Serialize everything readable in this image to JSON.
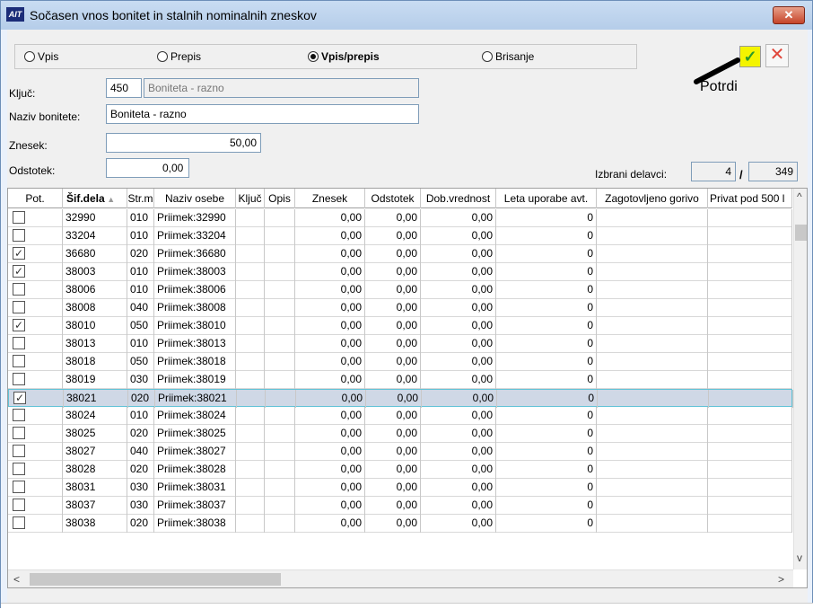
{
  "window": {
    "title": "Sočasen vnos bonitet in stalnih nominalnih zneskov",
    "icon_text": "AIT",
    "close_symbol": "✕"
  },
  "modes": [
    {
      "label": "Vpis",
      "selected": false
    },
    {
      "label": "Prepis",
      "selected": false
    },
    {
      "label": "Vpis/prepis",
      "selected": true
    },
    {
      "label": "Brisanje",
      "selected": false
    }
  ],
  "actions": {
    "confirm_symbol": "✓",
    "cancel_symbol": "✕",
    "annotation": "Potrdi"
  },
  "form": {
    "kljuc_label": "Ključ:",
    "kljuc_value": "450",
    "kljuc_desc": "Boniteta - razno",
    "naziv_label": "Naziv bonitete:",
    "naziv_value": "Boniteta - razno",
    "znesek_label": "Znesek:",
    "znesek_value": "50,00",
    "odstotek_label": "Odstotek:",
    "odstotek_value": "0,00",
    "izbrani_label": "Izbrani delavci:",
    "izbrani_count": "4",
    "izbrani_sep": "/",
    "izbrani_total": "349"
  },
  "grid": {
    "columns": [
      "Pot.",
      "Šif.dela",
      "Str.m",
      "Naziv osebe",
      "Ključ",
      "Opis",
      "Znesek",
      "Odstotek",
      "Dob.vrednost",
      "Leta uporabe avt.",
      "Zagotovljeno gorivo",
      "Privat pod 500 l"
    ],
    "rows": [
      {
        "pot": false,
        "sif": "32990",
        "str": "010",
        "naziv": "Priimek:32990",
        "znesek": "0,00",
        "odstotek": "0,00",
        "dob": "0,00",
        "leta": "0"
      },
      {
        "pot": false,
        "sif": "33204",
        "str": "010",
        "naziv": "Priimek:33204",
        "znesek": "0,00",
        "odstotek": "0,00",
        "dob": "0,00",
        "leta": "0"
      },
      {
        "pot": true,
        "sif": "36680",
        "str": "020",
        "naziv": "Priimek:36680",
        "znesek": "0,00",
        "odstotek": "0,00",
        "dob": "0,00",
        "leta": "0"
      },
      {
        "pot": true,
        "sif": "38003",
        "str": "010",
        "naziv": "Priimek:38003",
        "znesek": "0,00",
        "odstotek": "0,00",
        "dob": "0,00",
        "leta": "0"
      },
      {
        "pot": false,
        "sif": "38006",
        "str": "010",
        "naziv": "Priimek:38006",
        "znesek": "0,00",
        "odstotek": "0,00",
        "dob": "0,00",
        "leta": "0"
      },
      {
        "pot": false,
        "sif": "38008",
        "str": "040",
        "naziv": "Priimek:38008",
        "znesek": "0,00",
        "odstotek": "0,00",
        "dob": "0,00",
        "leta": "0"
      },
      {
        "pot": true,
        "sif": "38010",
        "str": "050",
        "naziv": "Priimek:38010",
        "znesek": "0,00",
        "odstotek": "0,00",
        "dob": "0,00",
        "leta": "0"
      },
      {
        "pot": false,
        "sif": "38013",
        "str": "010",
        "naziv": "Priimek:38013",
        "znesek": "0,00",
        "odstotek": "0,00",
        "dob": "0,00",
        "leta": "0"
      },
      {
        "pot": false,
        "sif": "38018",
        "str": "050",
        "naziv": "Priimek:38018",
        "znesek": "0,00",
        "odstotek": "0,00",
        "dob": "0,00",
        "leta": "0"
      },
      {
        "pot": false,
        "sif": "38019",
        "str": "030",
        "naziv": "Priimek:38019",
        "znesek": "0,00",
        "odstotek": "0,00",
        "dob": "0,00",
        "leta": "0"
      },
      {
        "pot": true,
        "sif": "38021",
        "str": "020",
        "naziv": "Priimek:38021",
        "znesek": "0,00",
        "odstotek": "0,00",
        "dob": "0,00",
        "leta": "0",
        "selected": true
      },
      {
        "pot": false,
        "sif": "38024",
        "str": "010",
        "naziv": "Priimek:38024",
        "znesek": "0,00",
        "odstotek": "0,00",
        "dob": "0,00",
        "leta": "0"
      },
      {
        "pot": false,
        "sif": "38025",
        "str": "020",
        "naziv": "Priimek:38025",
        "znesek": "0,00",
        "odstotek": "0,00",
        "dob": "0,00",
        "leta": "0"
      },
      {
        "pot": false,
        "sif": "38027",
        "str": "040",
        "naziv": "Priimek:38027",
        "znesek": "0,00",
        "odstotek": "0,00",
        "dob": "0,00",
        "leta": "0"
      },
      {
        "pot": false,
        "sif": "38028",
        "str": "020",
        "naziv": "Priimek:38028",
        "znesek": "0,00",
        "odstotek": "0,00",
        "dob": "0,00",
        "leta": "0"
      },
      {
        "pot": false,
        "sif": "38031",
        "str": "030",
        "naziv": "Priimek:38031",
        "znesek": "0,00",
        "odstotek": "0,00",
        "dob": "0,00",
        "leta": "0"
      },
      {
        "pot": false,
        "sif": "38037",
        "str": "030",
        "naziv": "Priimek:38037",
        "znesek": "0,00",
        "odstotek": "0,00",
        "dob": "0,00",
        "leta": "0"
      },
      {
        "pot": false,
        "sif": "38038",
        "str": "020",
        "naziv": "Priimek:38038",
        "znesek": "0,00",
        "odstotek": "0,00",
        "dob": "0,00",
        "leta": "0"
      }
    ]
  },
  "colors": {
    "accent": "#62c3d7",
    "confirm_bg": "#f4f400",
    "cancel": "#e0463a"
  }
}
